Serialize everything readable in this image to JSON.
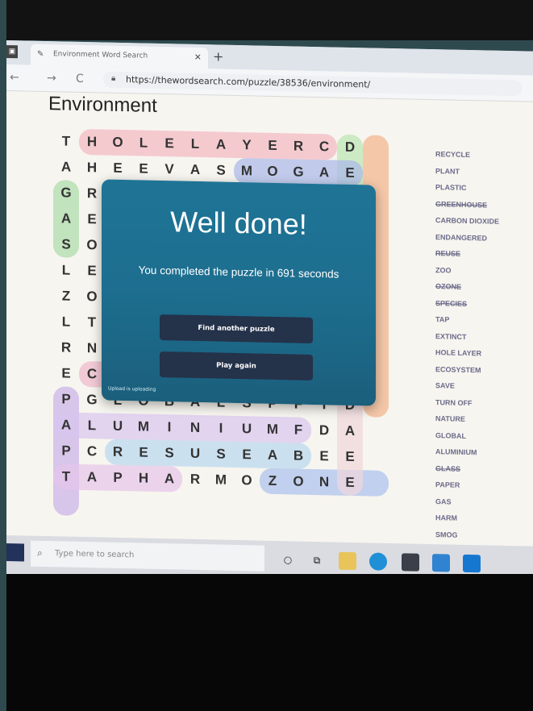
{
  "browser": {
    "tab_title": "Environment Word Search",
    "tab_close": "×",
    "new_tab": "+",
    "back": "←",
    "forward": "→",
    "reload": "C",
    "url": "https://thewordsearch.com/puzzle/38536/environment/"
  },
  "page": {
    "title": "Environment"
  },
  "grid": {
    "rows": [
      "THOLELAYERCD",
      "AHEEVASMOGAE",
      "GR_________R",
      "AE_________E",
      "SO_________G",
      "LE_________N",
      "ZO_________A",
      "LT_________D",
      "RN_________N",
      "ECTTSALPLOXE",
      "PGLOBALSPFID",
      "ALUMINIUMFDA",
      "PCRESUSEABEE",
      "TAPHARMOZONE"
    ]
  },
  "word_list": [
    {
      "word": "RECYCLE",
      "found": false
    },
    {
      "word": "PLANT",
      "found": false
    },
    {
      "word": "PLASTIC",
      "found": false
    },
    {
      "word": "GREENHOUSE",
      "found": true
    },
    {
      "word": "CARBON DIOXIDE",
      "found": false
    },
    {
      "word": "ENDANGERED",
      "found": false
    },
    {
      "word": "REUSE",
      "found": true
    },
    {
      "word": "ZOO",
      "found": false
    },
    {
      "word": "OZONE",
      "found": true
    },
    {
      "word": "SPECIES",
      "found": true
    },
    {
      "word": "TAP",
      "found": false
    },
    {
      "word": "EXTINCT",
      "found": false
    },
    {
      "word": "HOLE LAYER",
      "found": false
    },
    {
      "word": "ECOSYSTEM",
      "found": false
    },
    {
      "word": "SAVE",
      "found": false
    },
    {
      "word": "TURN OFF",
      "found": false
    },
    {
      "word": "NATURE",
      "found": false
    },
    {
      "word": "GLOBAL",
      "found": false
    },
    {
      "word": "ALUMINIUM",
      "found": false
    },
    {
      "word": "GLASS",
      "found": true
    },
    {
      "word": "PAPER",
      "found": false
    },
    {
      "word": "GAS",
      "found": false
    },
    {
      "word": "HARM",
      "found": false
    },
    {
      "word": "SMOG",
      "found": false
    }
  ],
  "modal": {
    "title": "Well done!",
    "message": "You completed the puzzle in 691 seconds",
    "find_another": "Find another puzzle",
    "play_again": "Play again",
    "credit": "Upload is uploading"
  },
  "taskbar": {
    "search_placeholder": "Type here to search",
    "cortana": "○",
    "taskview": "⧉"
  },
  "colors": {
    "modal_bg": "#1f7496",
    "button_bg": "#24324a"
  }
}
